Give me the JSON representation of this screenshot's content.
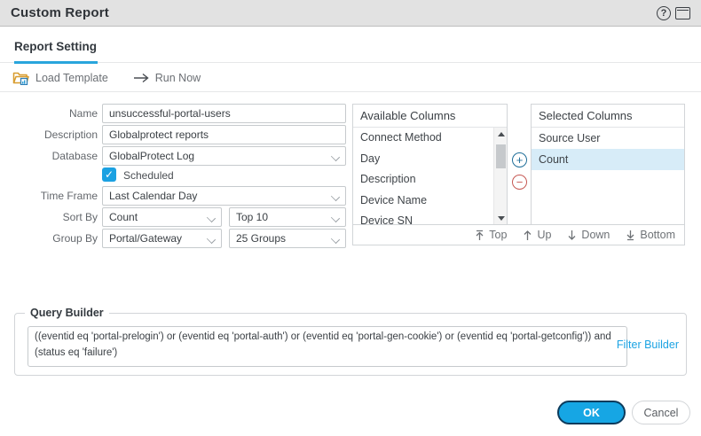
{
  "window": {
    "title": "Custom Report"
  },
  "tabs": {
    "report_setting": "Report Setting"
  },
  "toolbar": {
    "load_template": "Load Template",
    "run_now": "Run Now"
  },
  "form": {
    "name": {
      "label": "Name",
      "value": "unsuccessful-portal-users"
    },
    "description": {
      "label": "Description",
      "value": "Globalprotect reports"
    },
    "database": {
      "label": "Database",
      "value": "GlobalProtect Log"
    },
    "scheduled": {
      "label": "Scheduled",
      "checked": true
    },
    "time_frame": {
      "label": "Time Frame",
      "value": "Last Calendar Day"
    },
    "sort_by": {
      "label": "Sort By",
      "value": "Count",
      "limit_value": "Top 10"
    },
    "group_by": {
      "label": "Group By",
      "value": "Portal/Gateway",
      "groups_value": "25 Groups"
    }
  },
  "columns": {
    "available": {
      "header": "Available Columns",
      "items": [
        "Connect Method",
        "Day",
        "Description",
        "Device Name",
        "Device SN"
      ]
    },
    "selected": {
      "header": "Selected Columns",
      "items": [
        {
          "label": "Source User",
          "selected": false
        },
        {
          "label": "Count",
          "selected": true
        }
      ]
    },
    "order_buttons": {
      "top": "Top",
      "up": "Up",
      "down": "Down",
      "bottom": "Bottom"
    }
  },
  "query_builder": {
    "legend": "Query Builder",
    "query": "((eventid eq 'portal-prelogin') or (eventid eq 'portal-auth') or (eventid eq 'portal-gen-cookie') or (eventid eq 'portal-getconfig')) and (status eq 'failure')",
    "filter_builder_label": "Filter Builder"
  },
  "footer": {
    "ok_label": "OK",
    "cancel_label": "Cancel"
  },
  "icons": {
    "help": "?",
    "check": "✓",
    "plus": "+",
    "minus": "−"
  },
  "colors": {
    "accent_blue": "#29a5dc",
    "link_blue": "#1ba3e3",
    "selected_row": "#d7ecf8",
    "ok_button": "#16a6e4",
    "ok_ring": "#0d3b5c",
    "plus_blue": "#1f6e99",
    "minus_red": "#c65853",
    "checkbox_blue": "#1ba1e2",
    "titlebar_gray": "#e2e2e2"
  }
}
